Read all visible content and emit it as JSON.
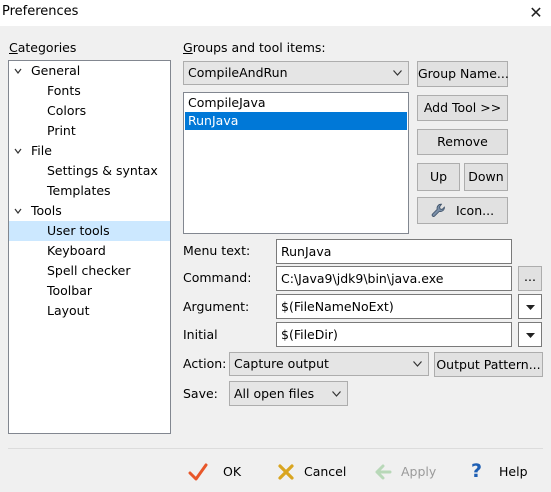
{
  "window": {
    "title": "Preferences"
  },
  "categories": {
    "label": "Categories",
    "items": [
      {
        "label": "General",
        "level": 0,
        "expanded": true
      },
      {
        "label": "Fonts",
        "level": 1
      },
      {
        "label": "Colors",
        "level": 1
      },
      {
        "label": "Print",
        "level": 1
      },
      {
        "label": "File",
        "level": 0,
        "expanded": true
      },
      {
        "label": "Settings & syntax",
        "level": 1
      },
      {
        "label": "Templates",
        "level": 1
      },
      {
        "label": "Tools",
        "level": 0,
        "expanded": true
      },
      {
        "label": "User tools",
        "level": 1,
        "selected": true
      },
      {
        "label": "Keyboard",
        "level": 1
      },
      {
        "label": "Spell checker",
        "level": 1
      },
      {
        "label": "Toolbar",
        "level": 1
      },
      {
        "label": "Layout",
        "level": 1
      }
    ]
  },
  "groups": {
    "label": "Groups and tool items:",
    "selected_group": "CompileAndRun",
    "items": [
      {
        "label": "CompileJava",
        "selected": false
      },
      {
        "label": "RunJava",
        "selected": true
      }
    ]
  },
  "buttons": {
    "group_name": "Group Name...",
    "add_tool": "Add Tool >>",
    "remove": "Remove",
    "up": "Up",
    "down": "Down",
    "icon": "Icon...",
    "browse": "...",
    "output_pattern": "Output Pattern..."
  },
  "form": {
    "menu_text_label": "Menu text:",
    "menu_text_value": "RunJava",
    "command_label": "Command:",
    "command_value": "C:\\Java9\\jdk9\\bin\\java.exe",
    "argument_label": "Argument:",
    "argument_value": "$(FileNameNoExt)",
    "initial_label": "Initial",
    "initial_value": "$(FileDir)",
    "action_label": "Action:",
    "action_value": "Capture output",
    "save_label": "Save:",
    "save_value": "All open files"
  },
  "footer": {
    "ok": "OK",
    "cancel": "Cancel",
    "apply": "Apply",
    "help": "Help"
  },
  "colors": {
    "selection_blue": "#0078d7",
    "tree_selection": "#cce8ff",
    "ok_check": "#e8572a",
    "cancel_x": "#d9a520",
    "help_blue": "#1e5fb4"
  },
  "icons": {
    "ok": "checkmark-icon",
    "cancel": "cross-icon",
    "apply": "arrow-left-icon",
    "help": "question-icon",
    "tool": "wrench-icon"
  }
}
